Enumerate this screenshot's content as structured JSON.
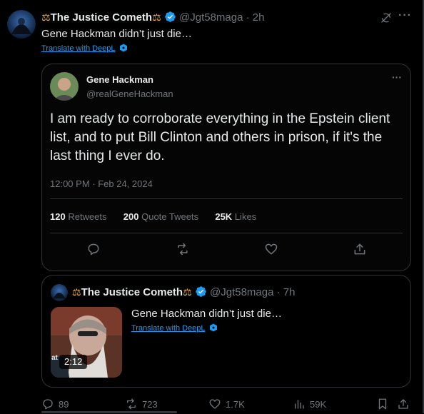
{
  "post": {
    "display_name": "The Justice Cometh",
    "handle": "@Jgt58maga",
    "time": "2h",
    "text": "Gene Hackman didn’t just die…",
    "translate": "Translate with DeepL"
  },
  "screenshot_tweet": {
    "name": "Gene Hackman",
    "handle": "@realGeneHackman",
    "body": "I am ready to corroborate everything in the Epstein client list, and to put Bill Clinton and others in prison, if it's the last thing I ever do.",
    "timestamp": "12:00 PM · Feb 24, 2024",
    "retweets_count": "120",
    "retweets_label": "Retweets",
    "quotes_count": "200",
    "quotes_label": "Quote Tweets",
    "likes_count": "25K",
    "likes_label": "Likes",
    "more": "···"
  },
  "quoted_post": {
    "display_name": "The Justice Cometh",
    "handle": "@Jgt58maga",
    "time": "7h",
    "text": "Gene Hackman didn’t just die…",
    "translate": "Translate with DeepL",
    "video_duration": "2:12",
    "thumb_partial_text": "at"
  },
  "actions": {
    "replies": "89",
    "reposts": "723",
    "likes": "1.7K",
    "views": "59K"
  },
  "more": "···",
  "colors": {
    "background": "#000000",
    "text": "#e7e9ea",
    "muted": "#71767b",
    "accent": "#1d9bf0",
    "border": "#2f3336",
    "verified": "#1d9bf0"
  }
}
